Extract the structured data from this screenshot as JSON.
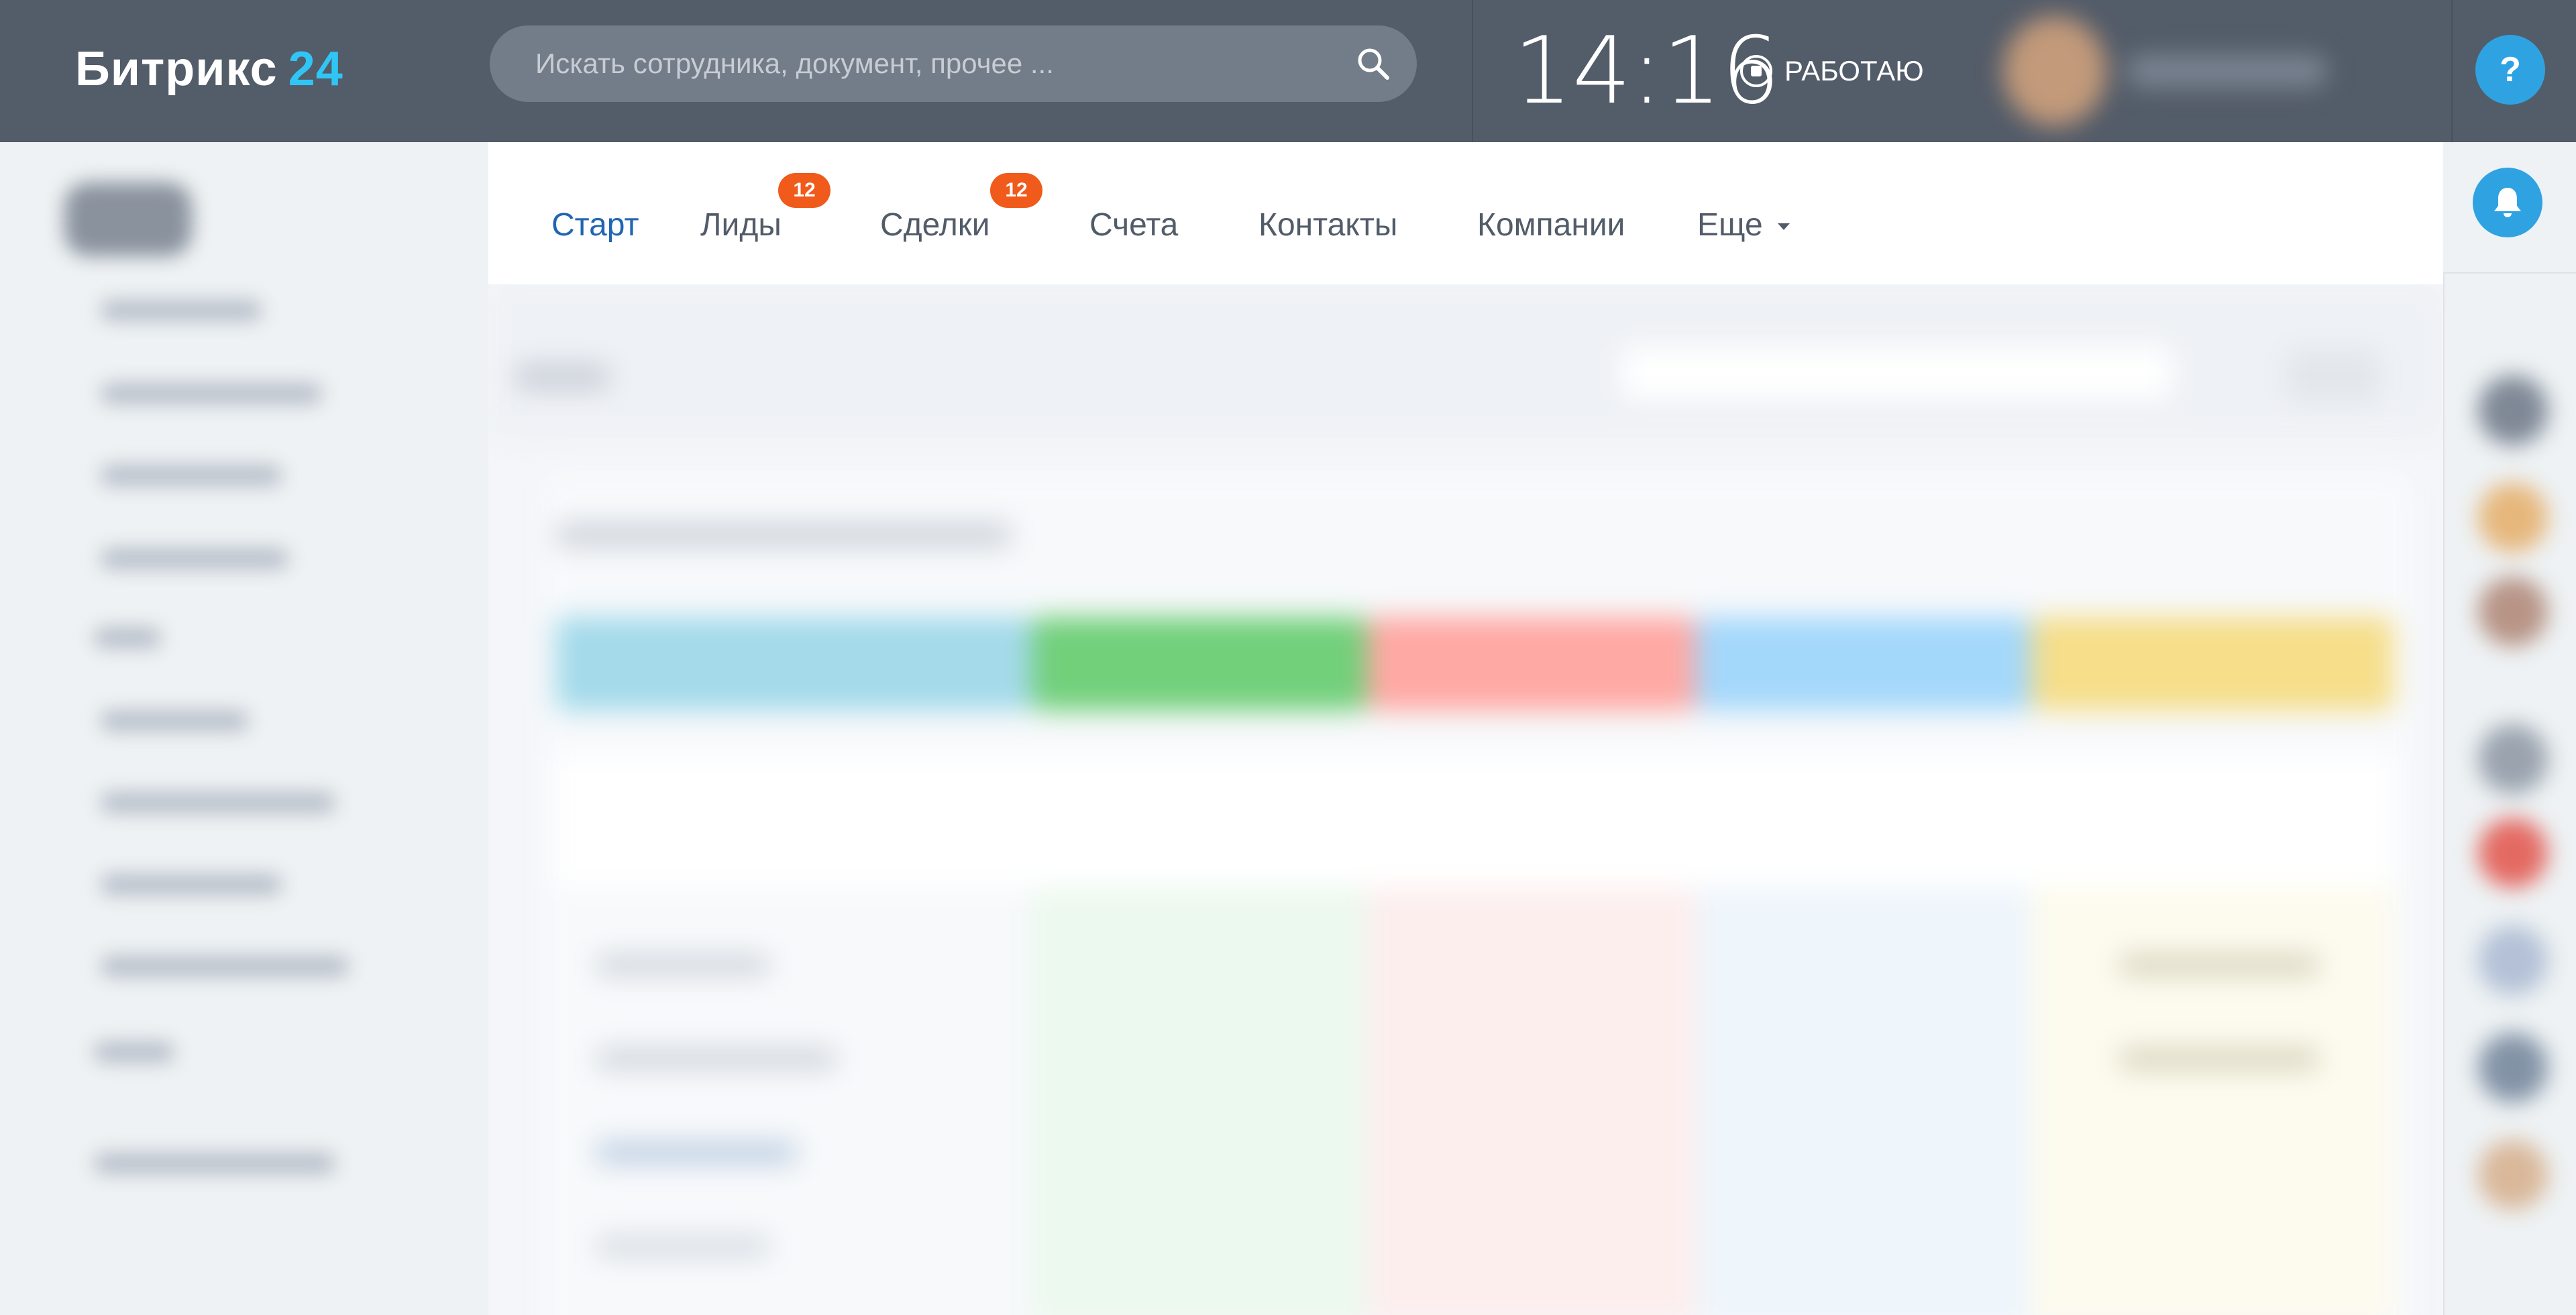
{
  "header": {
    "logo_text": "Битрикс",
    "logo_number": "24",
    "search_placeholder": "Искать сотрудника, документ, прочее ...",
    "time": "14:16",
    "status_label": "РАБОТАЮ",
    "help_label": "?"
  },
  "menu": {
    "tabs": [
      {
        "label": "Старт",
        "active": true
      },
      {
        "label": "Лиды",
        "badge": "12"
      },
      {
        "label": "Сделки",
        "badge": "12"
      },
      {
        "label": "Счета"
      },
      {
        "label": "Контакты"
      },
      {
        "label": "Компании"
      },
      {
        "label": "Еще"
      }
    ]
  },
  "colors": {
    "header_bg": "#535c69",
    "accent_blue": "#2fc6f6",
    "active_tab": "#2066b0",
    "badge_bg": "#f05a1a",
    "circle_button": "#2fa3e2"
  },
  "icons": {
    "search": "search-icon",
    "status": "stop-circle-icon",
    "bell": "bell-icon",
    "more": "chevron-down-icon"
  }
}
